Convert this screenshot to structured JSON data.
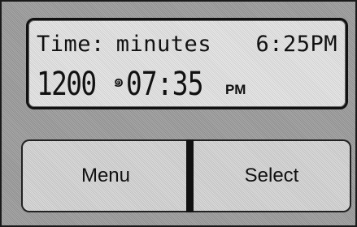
{
  "display": {
    "line1": {
      "label": "Time:",
      "mode": "minutes",
      "current_time": "6:25PM"
    },
    "line2": {
      "year": "1200",
      "separator_icon": "spiral-icon",
      "separator_glyph": "๑",
      "time": "07:35",
      "ampm": "PM"
    }
  },
  "buttons": {
    "menu_label": "Menu",
    "select_label": "Select"
  }
}
